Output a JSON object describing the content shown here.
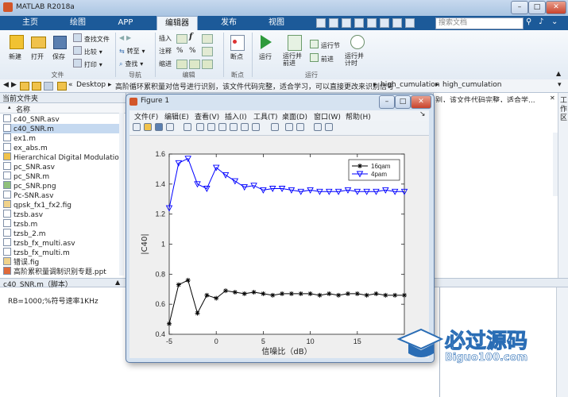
{
  "app": {
    "title": "MATLAB R2018a",
    "search_placeholder": "搜索文档",
    "tabs": [
      {
        "label": "主页"
      },
      {
        "label": "绘图"
      },
      {
        "label": "APP"
      },
      {
        "label": "编辑器"
      },
      {
        "label": "发布"
      },
      {
        "label": "视图"
      }
    ],
    "active_tab_index": 3
  },
  "ribbon": {
    "file_group": {
      "label": "文件",
      "new": "新建",
      "open": "打开",
      "save": "保存",
      "find_files": "查找文件",
      "compare": "比较",
      "print": "打印"
    },
    "nav_group": {
      "label": "导航",
      "goto": "转至",
      "find": "查找"
    },
    "edit_group": {
      "label": "编辑",
      "insert": "插入",
      "comment": "注释",
      "indent": "缩进"
    },
    "breakpoints": {
      "label": "断点",
      "button": "断点"
    },
    "run_group": {
      "label": "运行",
      "run": "运行",
      "run_advance": "运行并\n前进",
      "run_section": "运行节",
      "advance": "前进",
      "run_time": "运行并\n计时"
    }
  },
  "address": {
    "segments": [
      "Desktop",
      "高阶循环累积量对信号进行识别，该文件代码完整，适合学习，可以直接更改来识别信号",
      "high_cumulation",
      "high_cumulation"
    ]
  },
  "current_folder": {
    "header": "当前文件夹",
    "column_name": "名称",
    "files": [
      {
        "name": "c40_SNR.asv",
        "type": "asv"
      },
      {
        "name": "c40_SNR.m",
        "type": "m",
        "selected": true
      },
      {
        "name": "ex1.m",
        "type": "m"
      },
      {
        "name": "ex_abs.m",
        "type": "m"
      },
      {
        "name": "Hierarchical Digital Modulation",
        "type": "doc"
      },
      {
        "name": "pc_SNR.asv",
        "type": "asv"
      },
      {
        "name": "pc_SNR.m",
        "type": "m"
      },
      {
        "name": "pc_SNR.png",
        "type": "png"
      },
      {
        "name": "Pc-SNR.asv",
        "type": "asv"
      },
      {
        "name": "qpsk_fx1_fx2.fig",
        "type": "fig"
      },
      {
        "name": "tzsb.asv",
        "type": "asv"
      },
      {
        "name": "tzsb.m",
        "type": "m"
      },
      {
        "name": "tzsb_2.m",
        "type": "m"
      },
      {
        "name": "tzsb_fx_multi.asv",
        "type": "asv"
      },
      {
        "name": "tzsb_fx_multi.m",
        "type": "m"
      },
      {
        "name": "错误.fig",
        "type": "fig"
      },
      {
        "name": "高阶累积量调制识别专题.ppt",
        "type": "ppt"
      }
    ]
  },
  "details": {
    "title": "c40_SNR.m（脚本）",
    "text": "RB=1000;%符号速率1KHz"
  },
  "right_panel": {
    "header_fragment": "别，该文件代码完整，适合学..."
  },
  "workspace_tab": "工作区",
  "figure": {
    "title": "Figure 1",
    "menu": [
      "文件(F)",
      "编辑(E)",
      "查看(V)",
      "插入(I)",
      "工具(T)",
      "桌面(D)",
      "窗口(W)",
      "帮助(H)"
    ]
  },
  "chart_data": {
    "type": "line",
    "title": "",
    "xlabel": "信噪比（dB）",
    "ylabel": "|C40|",
    "xlim": [
      -5,
      20
    ],
    "ylim": [
      0.4,
      1.6
    ],
    "x_ticks": [
      -5,
      0,
      5,
      10,
      15
    ],
    "y_ticks": [
      0.4,
      0.6,
      0.8,
      1.0,
      1.2,
      1.4,
      1.6
    ],
    "x_tick_labels": [
      "-5",
      "0",
      "5",
      "10",
      "15"
    ],
    "y_tick_labels": [
      "0.4",
      "0.6",
      "0.8",
      "1",
      "1.2",
      "1.4",
      "1.6"
    ],
    "grid": false,
    "legend_position": "top-right",
    "x": [
      -5,
      -4,
      -3,
      -2,
      -1,
      0,
      1,
      2,
      3,
      4,
      5,
      6,
      7,
      8,
      9,
      10,
      11,
      12,
      13,
      14,
      15,
      16,
      17,
      18,
      19,
      20
    ],
    "series": [
      {
        "name": "16qam",
        "color": "#000000",
        "marker": "asterisk",
        "values": [
          0.47,
          0.73,
          0.76,
          0.54,
          0.66,
          0.64,
          0.69,
          0.68,
          0.67,
          0.68,
          0.67,
          0.66,
          0.67,
          0.67,
          0.67,
          0.67,
          0.66,
          0.67,
          0.66,
          0.67,
          0.67,
          0.66,
          0.67,
          0.66,
          0.66,
          0.66
        ]
      },
      {
        "name": "4pam",
        "color": "#0000ff",
        "marker": "triangle-down",
        "values": [
          1.24,
          1.54,
          1.57,
          1.4,
          1.37,
          1.51,
          1.46,
          1.42,
          1.38,
          1.39,
          1.36,
          1.37,
          1.37,
          1.36,
          1.35,
          1.36,
          1.35,
          1.35,
          1.35,
          1.36,
          1.35,
          1.35,
          1.35,
          1.36,
          1.35,
          1.35
        ]
      }
    ]
  },
  "watermark": {
    "brand": "必过源码",
    "url": "Biguo100.com"
  },
  "colors": {
    "tab_bar": "#1c5a99",
    "accent": "#2a6db5"
  }
}
